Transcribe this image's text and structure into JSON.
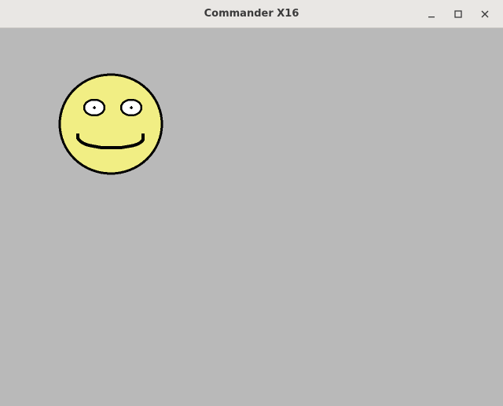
{
  "window": {
    "title": "Commander X16",
    "controls": [
      "minimize-icon",
      "maximize-icon",
      "close-icon"
    ]
  },
  "screen": {
    "background": "#b9b9b9",
    "drawing": {
      "type": "smiley-face",
      "face_fill": "#f1ee84",
      "outline": "#000000",
      "eye_fill": "#ffffff"
    }
  }
}
